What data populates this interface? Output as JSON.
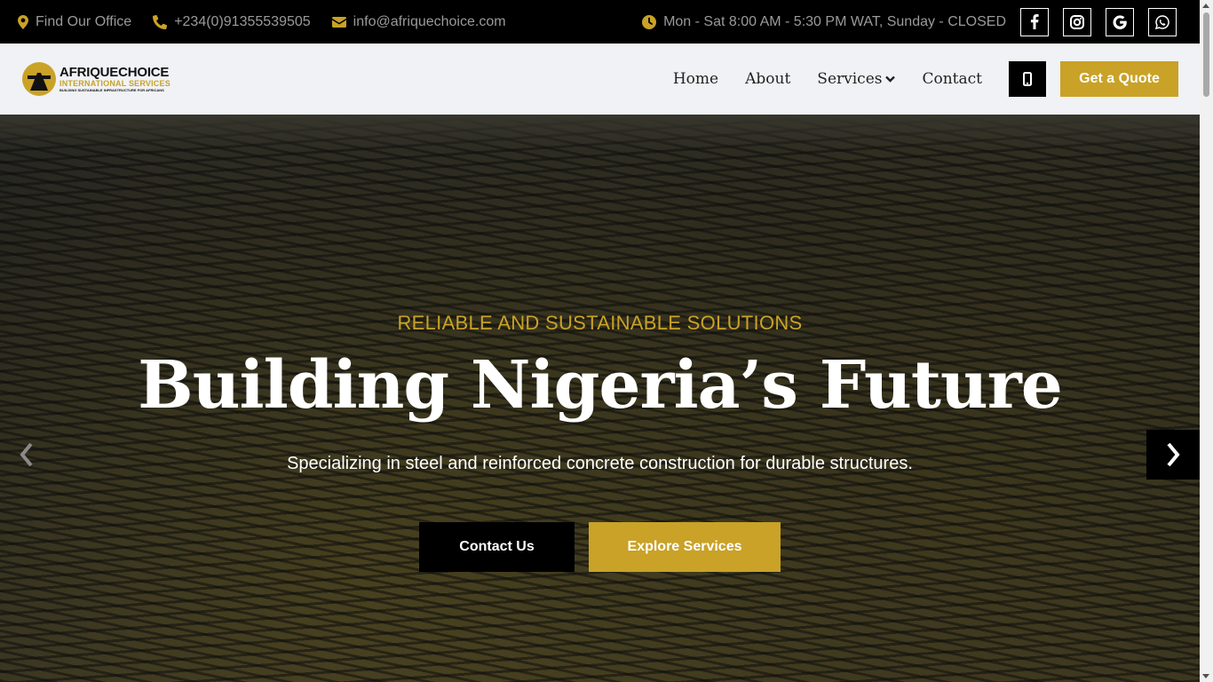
{
  "topbar": {
    "office": "Find Our Office",
    "phone": "+234(0)91355539505",
    "email": "info@afriquechoice.com",
    "hours": "Mon - Sat 8:00 AM - 5:30 PM WAT, Sunday - CLOSED",
    "social_icons": [
      "facebook-icon",
      "instagram-icon",
      "google-icon",
      "whatsapp-icon"
    ]
  },
  "logo": {
    "line1": "AFRIQUECHOICE",
    "line2": "INTERNATIONAL SERVICES",
    "line3": "BUILDING SUSTAINABLE INFRASTRUCTURE FOR AFRICANS"
  },
  "nav": {
    "home": "Home",
    "about": "About",
    "services": "Services",
    "contact": "Contact",
    "quote": "Get a Quote"
  },
  "hero": {
    "eyebrow": "RELIABLE AND SUSTAINABLE SOLUTIONS",
    "title": "Building Nigeria’s Future",
    "subtitle": "Specializing in steel and reinforced concrete construction for durable structures.",
    "contact_button": "Contact Us",
    "explore_button": "Explore Services"
  },
  "colors": {
    "accent": "#c9a227",
    "topbar_bg": "#000000",
    "header_bg": "#f0f2f5"
  }
}
